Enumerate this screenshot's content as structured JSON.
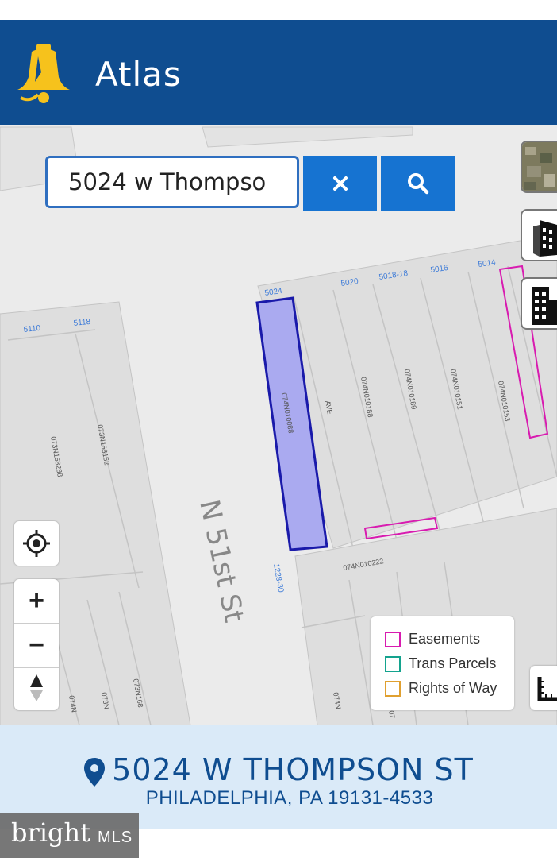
{
  "header": {
    "title": "Atlas",
    "logo_icon": "liberty-bell-icon"
  },
  "search": {
    "value": "5024 w Thompso",
    "clear_icon": "close-icon",
    "search_icon": "search-icon"
  },
  "side_buttons": [
    {
      "name": "imagery-toggle",
      "icon": "aerial-thumbnail"
    },
    {
      "name": "pictometry-toggle",
      "icon": "building-3d-icon"
    },
    {
      "name": "cyclomedia-toggle",
      "icon": "building-icon"
    }
  ],
  "map": {
    "street_label": "N 51st St",
    "lot_numbers": [
      "5024",
      "5020",
      "5018-18",
      "5016",
      "5014",
      "5110",
      "5118",
      "1228-30"
    ],
    "parcel_ids": [
      "074N010088",
      "AVE",
      "074N010188",
      "074N010189",
      "074N010151",
      "074N010153",
      "073N168288",
      "073N168152",
      "074N010222",
      "073N168",
      "074N",
      "073N",
      "074N",
      "07"
    ]
  },
  "controls": {
    "locate_icon": "locate-icon",
    "zoom_in": "+",
    "zoom_out": "−",
    "compass_icon": "compass-icon"
  },
  "legend": {
    "items": [
      {
        "label": "Easements",
        "color": "#d81bb0"
      },
      {
        "label": "Trans Parcels",
        "color": "#14a38e"
      },
      {
        "label": "Rights of Way",
        "color": "#e0a030"
      }
    ]
  },
  "address": {
    "line1": "5024 W THOMPSON ST",
    "line2": "PHILADELPHIA, PA 19131-4533"
  },
  "watermark": {
    "brand": "bright",
    "suffix": "MLS"
  },
  "colors": {
    "header": "#0f4d90",
    "button": "#1673d1",
    "selected_parcel": "#aaaaf0",
    "selected_outline": "#1a1aaa",
    "easement": "#d81bb0"
  }
}
